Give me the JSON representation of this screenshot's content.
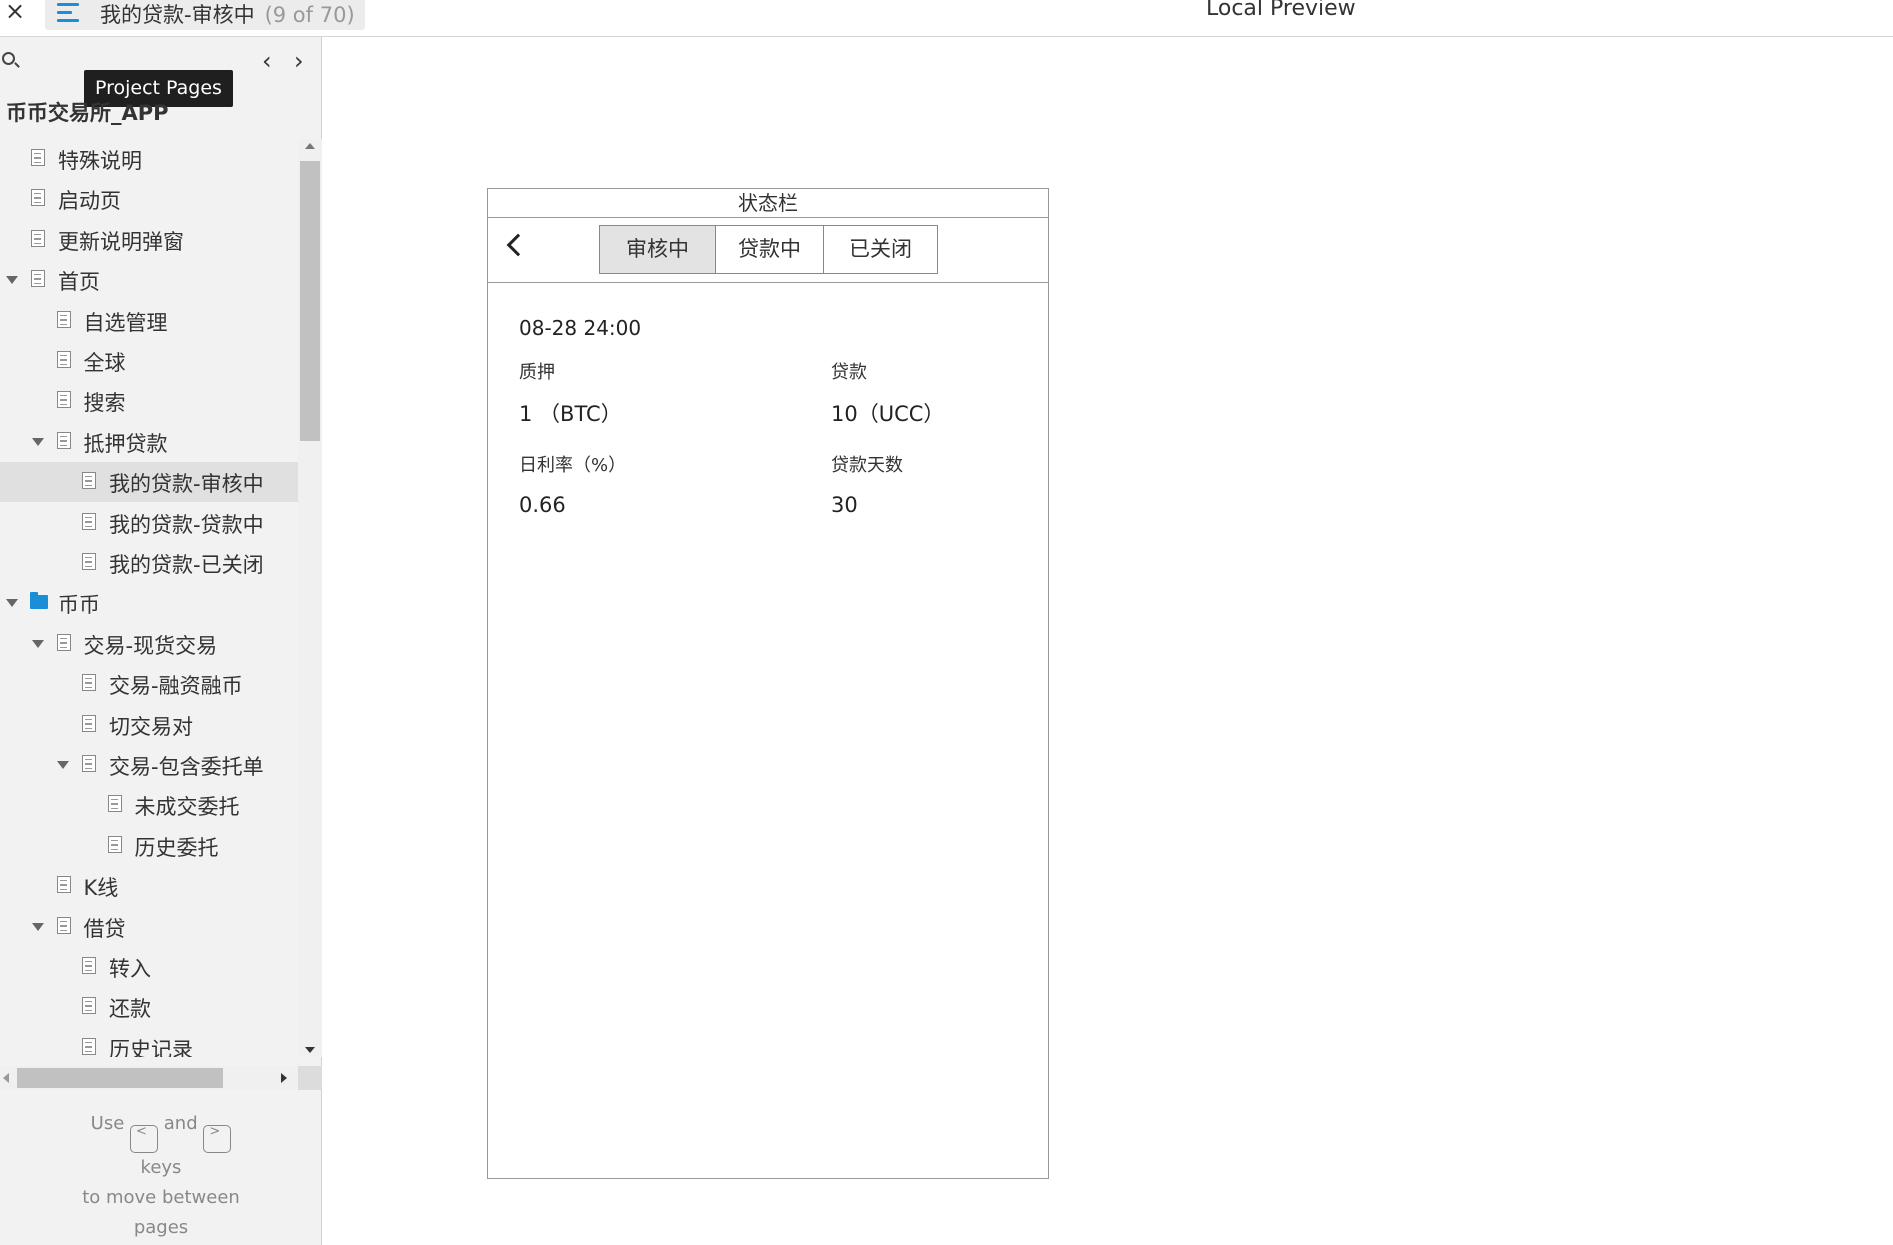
{
  "topbar": {
    "close_label": "×",
    "page_name": "我的贷款-审核中",
    "page_count": "(9 of 70)",
    "preview_title": "Local Preview"
  },
  "sidebar": {
    "tooltip": "Project Pages",
    "prev_label": "‹",
    "next_label": "›",
    "project_title": "币币交易所_APP",
    "items": [
      {
        "label": "特殊说明",
        "type": "page",
        "level": 0,
        "expanded": null,
        "selected": false
      },
      {
        "label": "启动页",
        "type": "page",
        "level": 0,
        "expanded": null,
        "selected": false
      },
      {
        "label": "更新说明弹窗",
        "type": "page",
        "level": 0,
        "expanded": null,
        "selected": false
      },
      {
        "label": "首页",
        "type": "page",
        "level": 0,
        "expanded": true,
        "selected": false
      },
      {
        "label": "自选管理",
        "type": "page",
        "level": 1,
        "expanded": null,
        "selected": false
      },
      {
        "label": "全球",
        "type": "page",
        "level": 1,
        "expanded": null,
        "selected": false
      },
      {
        "label": "搜索",
        "type": "page",
        "level": 1,
        "expanded": null,
        "selected": false
      },
      {
        "label": "抵押贷款",
        "type": "page",
        "level": 1,
        "expanded": true,
        "selected": false
      },
      {
        "label": "我的贷款-审核中",
        "type": "page",
        "level": 2,
        "expanded": null,
        "selected": true
      },
      {
        "label": "我的贷款-贷款中",
        "type": "page",
        "level": 2,
        "expanded": null,
        "selected": false
      },
      {
        "label": "我的贷款-已关闭",
        "type": "page",
        "level": 2,
        "expanded": null,
        "selected": false
      },
      {
        "label": "币币",
        "type": "folder",
        "level": 0,
        "expanded": true,
        "selected": false
      },
      {
        "label": "交易-现货交易",
        "type": "page",
        "level": 1,
        "expanded": true,
        "selected": false
      },
      {
        "label": "交易-融资融币",
        "type": "page",
        "level": 2,
        "expanded": null,
        "selected": false
      },
      {
        "label": "切交易对",
        "type": "page",
        "level": 2,
        "expanded": null,
        "selected": false
      },
      {
        "label": "交易-包含委托单",
        "type": "page",
        "level": 2,
        "expanded": true,
        "selected": false
      },
      {
        "label": "未成交委托",
        "type": "page",
        "level": 3,
        "expanded": null,
        "selected": false
      },
      {
        "label": "历史委托",
        "type": "page",
        "level": 3,
        "expanded": null,
        "selected": false
      },
      {
        "label": "K线",
        "type": "page",
        "level": 1,
        "expanded": null,
        "selected": false
      },
      {
        "label": "借贷",
        "type": "page",
        "level": 1,
        "expanded": true,
        "selected": false
      },
      {
        "label": "转入",
        "type": "page",
        "level": 2,
        "expanded": null,
        "selected": false
      },
      {
        "label": "还款",
        "type": "page",
        "level": 2,
        "expanded": null,
        "selected": false
      },
      {
        "label": "历史记录",
        "type": "page",
        "level": 2,
        "expanded": null,
        "selected": false
      }
    ],
    "help": {
      "use": "Use",
      "prev_key": "<",
      "and": "and",
      "next_key": ">",
      "line2": "keys",
      "line3": "to move between",
      "line4": "pages"
    }
  },
  "phone": {
    "statusbar": "状态栏",
    "tabs": [
      {
        "label": "审核中",
        "active": true
      },
      {
        "label": "贷款中",
        "active": false
      },
      {
        "label": "已关闭",
        "active": false
      }
    ],
    "datetime": "08-28 24:00",
    "fields": {
      "collateral_label": "质押",
      "collateral_value": "1 （BTC）",
      "loan_label": "贷款",
      "loan_value": "10（UCC）",
      "rate_label": "日利率（%）",
      "rate_value": "0.66",
      "days_label": "贷款天数",
      "days_value": "30"
    }
  }
}
